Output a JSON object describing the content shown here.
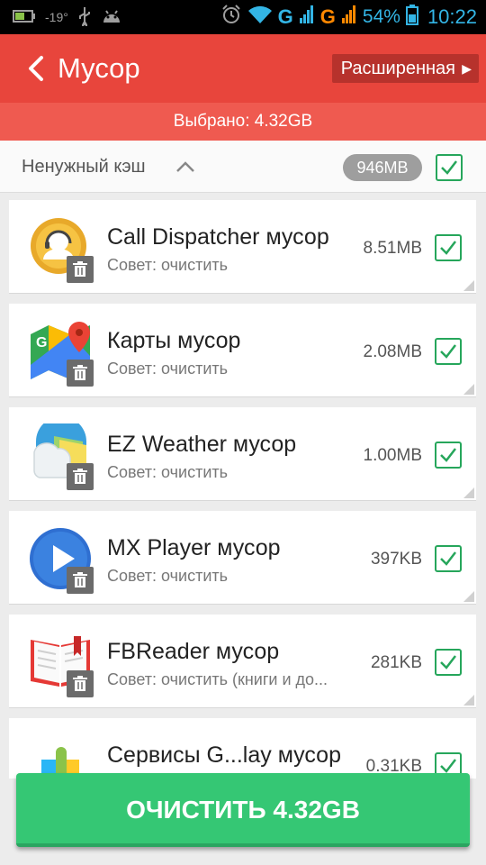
{
  "status_bar": {
    "temperature": "-19°",
    "battery_percent": "54%",
    "time": "10:22",
    "network_1": "G",
    "network_2": "G",
    "color": "#33b5e5"
  },
  "header": {
    "title": "Мусор",
    "advanced_label": "Расширенная",
    "selected_label": "Выбрано: 4.32GB",
    "color": "#e8453c"
  },
  "section": {
    "label": "Ненужный кэш",
    "size": "946MB",
    "checked": true
  },
  "items": [
    {
      "title": "Call Dispatcher мусор",
      "subtitle": "Совет: очистить",
      "size": "8.51MB",
      "icon": "call-dispatcher-icon",
      "checked": true
    },
    {
      "title": "Карты мусор",
      "subtitle": "Совет: очистить",
      "size": "2.08MB",
      "icon": "google-maps-icon",
      "checked": true
    },
    {
      "title": "EZ Weather мусор",
      "subtitle": "Совет: очистить",
      "size": "1.00MB",
      "icon": "ez-weather-icon",
      "checked": true
    },
    {
      "title": "MX Player мусор",
      "subtitle": "Совет: очистить",
      "size": "397KB",
      "icon": "mx-player-icon",
      "checked": true
    },
    {
      "title": "FBReader мусор",
      "subtitle": "Совет: очистить (книги и до...",
      "size": "281KB",
      "icon": "fbreader-icon",
      "checked": true
    },
    {
      "title": "Сервисы G...lay мусор",
      "subtitle": "",
      "size": "0.31KB",
      "icon": "google-play-services-icon",
      "checked": true
    }
  ],
  "clean_button": {
    "label": "ОЧИСТИТЬ 4.32GB",
    "color": "#35c774"
  }
}
